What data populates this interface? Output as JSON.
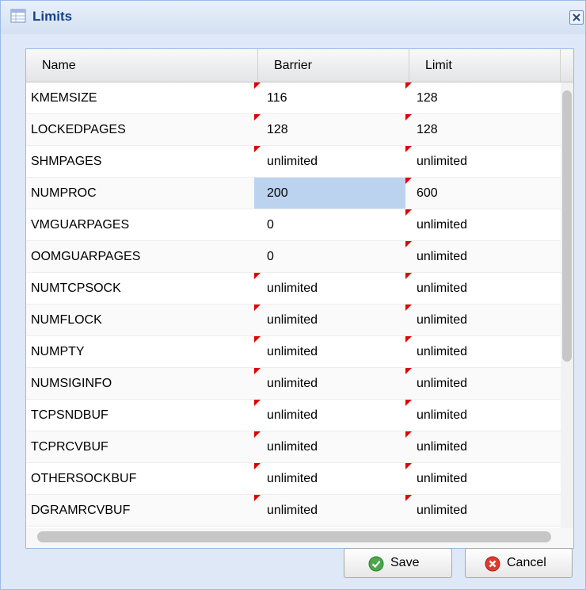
{
  "window": {
    "title": "Limits"
  },
  "grid": {
    "columns": [
      "Name",
      "Barrier",
      "Limit"
    ],
    "rows": [
      {
        "name": "KMEMSIZE",
        "barrier": "116",
        "limit": "128"
      },
      {
        "name": "LOCKEDPAGES",
        "barrier": "128",
        "limit": "128"
      },
      {
        "name": "SHMPAGES",
        "barrier": "unlimited",
        "limit": "unlimited"
      },
      {
        "name": "NUMPROC",
        "barrier": "200",
        "limit": "600"
      },
      {
        "name": "VMGUARPAGES",
        "barrier": "0",
        "limit": "unlimited"
      },
      {
        "name": "OOMGUARPAGES",
        "barrier": "0",
        "limit": "unlimited"
      },
      {
        "name": "NUMTCPSOCK",
        "barrier": "unlimited",
        "limit": "unlimited"
      },
      {
        "name": "NUMFLOCK",
        "barrier": "unlimited",
        "limit": "unlimited"
      },
      {
        "name": "NUMPTY",
        "barrier": "unlimited",
        "limit": "unlimited"
      },
      {
        "name": "NUMSIGINFO",
        "barrier": "unlimited",
        "limit": "unlimited"
      },
      {
        "name": "TCPSNDBUF",
        "barrier": "unlimited",
        "limit": "unlimited"
      },
      {
        "name": "TCPRCVBUF",
        "barrier": "unlimited",
        "limit": "unlimited"
      },
      {
        "name": "OTHERSOCKBUF",
        "barrier": "unlimited",
        "limit": "unlimited"
      },
      {
        "name": "DGRAMRCVBUF",
        "barrier": "unlimited",
        "limit": "unlimited"
      }
    ]
  },
  "buttons": {
    "save": "Save",
    "cancel": "Cancel"
  },
  "colors": {
    "dirty_marker": "#e00000",
    "selected_cell": "#bcd3f0",
    "title_text": "#15428b"
  },
  "icons": {
    "title": "table-icon",
    "close": "close-icon",
    "save": "check-circle-icon",
    "cancel": "x-circle-icon"
  }
}
